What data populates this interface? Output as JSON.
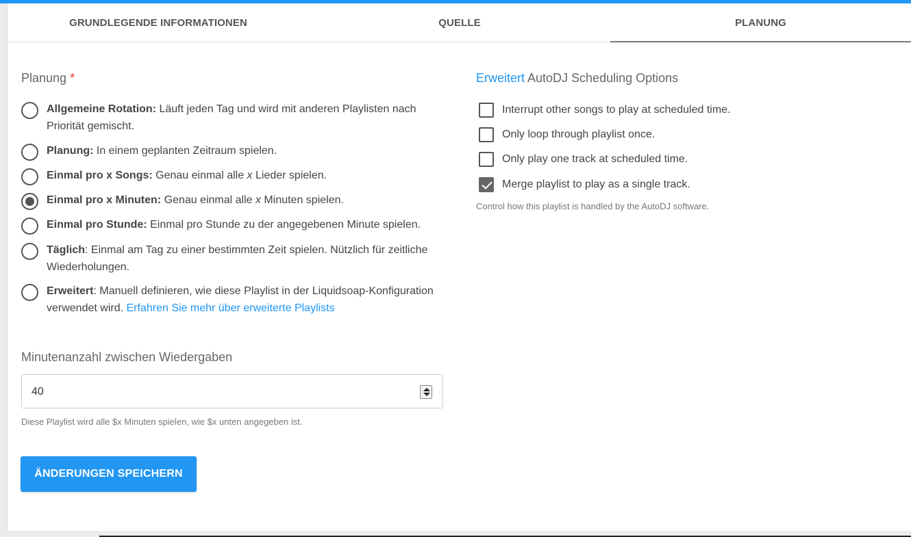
{
  "tabs": [
    {
      "label": "GRUNDLEGENDE INFORMATIONEN"
    },
    {
      "label": "QUELLE"
    },
    {
      "label": "PLANUNG"
    }
  ],
  "scheduling": {
    "title": "Planung",
    "required_mark": "*",
    "options": [
      {
        "bold": "Allgemeine Rotation:",
        "text": " Läuft jeden Tag und wird mit anderen Playlisten nach Priorität gemischt.",
        "checked": false
      },
      {
        "bold": "Planung:",
        "text": " In einem geplanten Zeitraum spielen.",
        "checked": false
      },
      {
        "bold": "Einmal pro x Songs:",
        "text_before": " Genau einmal alle ",
        "italic": "x",
        "text_after": " Lieder spielen.",
        "checked": false
      },
      {
        "bold": "Einmal pro x Minuten:",
        "text_before": " Genau einmal alle ",
        "italic": "x",
        "text_after": " Minuten spielen.",
        "checked": true
      },
      {
        "bold": "Einmal pro Stunde:",
        "text": " Einmal pro Stunde zu der angegebenen Minute spielen.",
        "checked": false
      },
      {
        "bold": "Täglich",
        "text": ": Einmal am Tag zu einer bestimmten Zeit spielen. Nützlich für zeitliche Wiederholungen.",
        "checked": false
      },
      {
        "bold": "Erweitert",
        "text": ": Manuell definieren, wie diese Playlist in der Liquidsoap-Konfiguration verwendet wird. ",
        "link": "Erfahren Sie mehr über erweiterte Playlists",
        "checked": false
      }
    ]
  },
  "minutes_field": {
    "label": "Minutenanzahl zwischen Wiedergaben",
    "value": "40",
    "help": "Diese Playlist wird alle $x Minuten spielen, wie $x unten angegeben ist."
  },
  "save_button": "ÄNDERUNGEN SPEICHERN",
  "advanced": {
    "title_highlight": "Erweitert",
    "title_rest": " AutoDJ Scheduling Options",
    "options": [
      {
        "label": "Interrupt other songs to play at scheduled time.",
        "checked": false
      },
      {
        "label": "Only loop through playlist once.",
        "checked": false
      },
      {
        "label": "Only play one track at scheduled time.",
        "checked": false
      },
      {
        "label": "Merge playlist to play as a single track.",
        "checked": true
      }
    ],
    "help": "Control how this playlist is handled by the AutoDJ software."
  },
  "colors": {
    "accent": "#2196f3",
    "required": "#e53935"
  }
}
